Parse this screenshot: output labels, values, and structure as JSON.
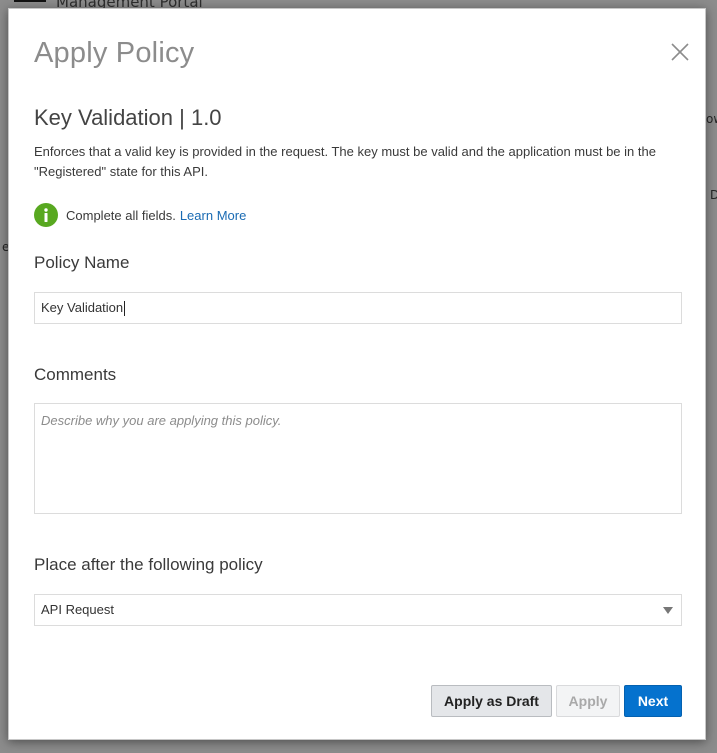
{
  "background": {
    "portal_title": "Management Portal",
    "fragments": [
      "ow",
      "D",
      "e"
    ]
  },
  "dialog": {
    "title": "Apply Policy",
    "policy_heading": "Key Validation | 1.0",
    "description": "Enforces that a valid key is provided in the request. The key must be valid and the application must be in the \"Registered\" state for this API.",
    "info_text": "Complete all fields.",
    "learn_more": "Learn More",
    "policy_name_label": "Policy Name",
    "policy_name_value": "Key Validation",
    "comments_label": "Comments",
    "comments_placeholder": "Describe why you are applying this policy.",
    "place_after_label": "Place after the following policy",
    "place_after_value": "API Request",
    "buttons": {
      "apply_draft": "Apply as Draft",
      "apply": "Apply",
      "next": "Next"
    }
  },
  "colors": {
    "info_icon": "#58a820",
    "link": "#1a6bb3",
    "primary_button": "#0572ce"
  },
  "icons": {
    "close": "close-icon",
    "info": "info-icon",
    "dropdown": "chevron-down-icon"
  }
}
